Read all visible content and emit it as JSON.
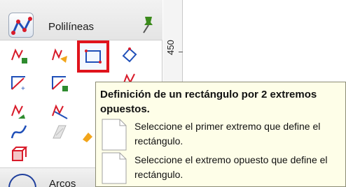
{
  "palette": {
    "title": "Polilíneas",
    "footer_label": "Arcos",
    "selected_tool": "rectangle-tool"
  },
  "ruler": {
    "label": "450"
  },
  "tooltip": {
    "title": "Definición de un rectángulo por 2 extremos opuestos.",
    "steps": [
      {
        "text": "Seleccione el primer extremo que define el rectángulo."
      },
      {
        "text": "Seleccione el extremo opuesto que define el rectángulo."
      }
    ]
  },
  "colors": {
    "selection_frame": "#e0141c",
    "tooltip_bg": "#fefee8",
    "tool_red": "#d81b2a",
    "tool_blue": "#1f4fb8"
  }
}
